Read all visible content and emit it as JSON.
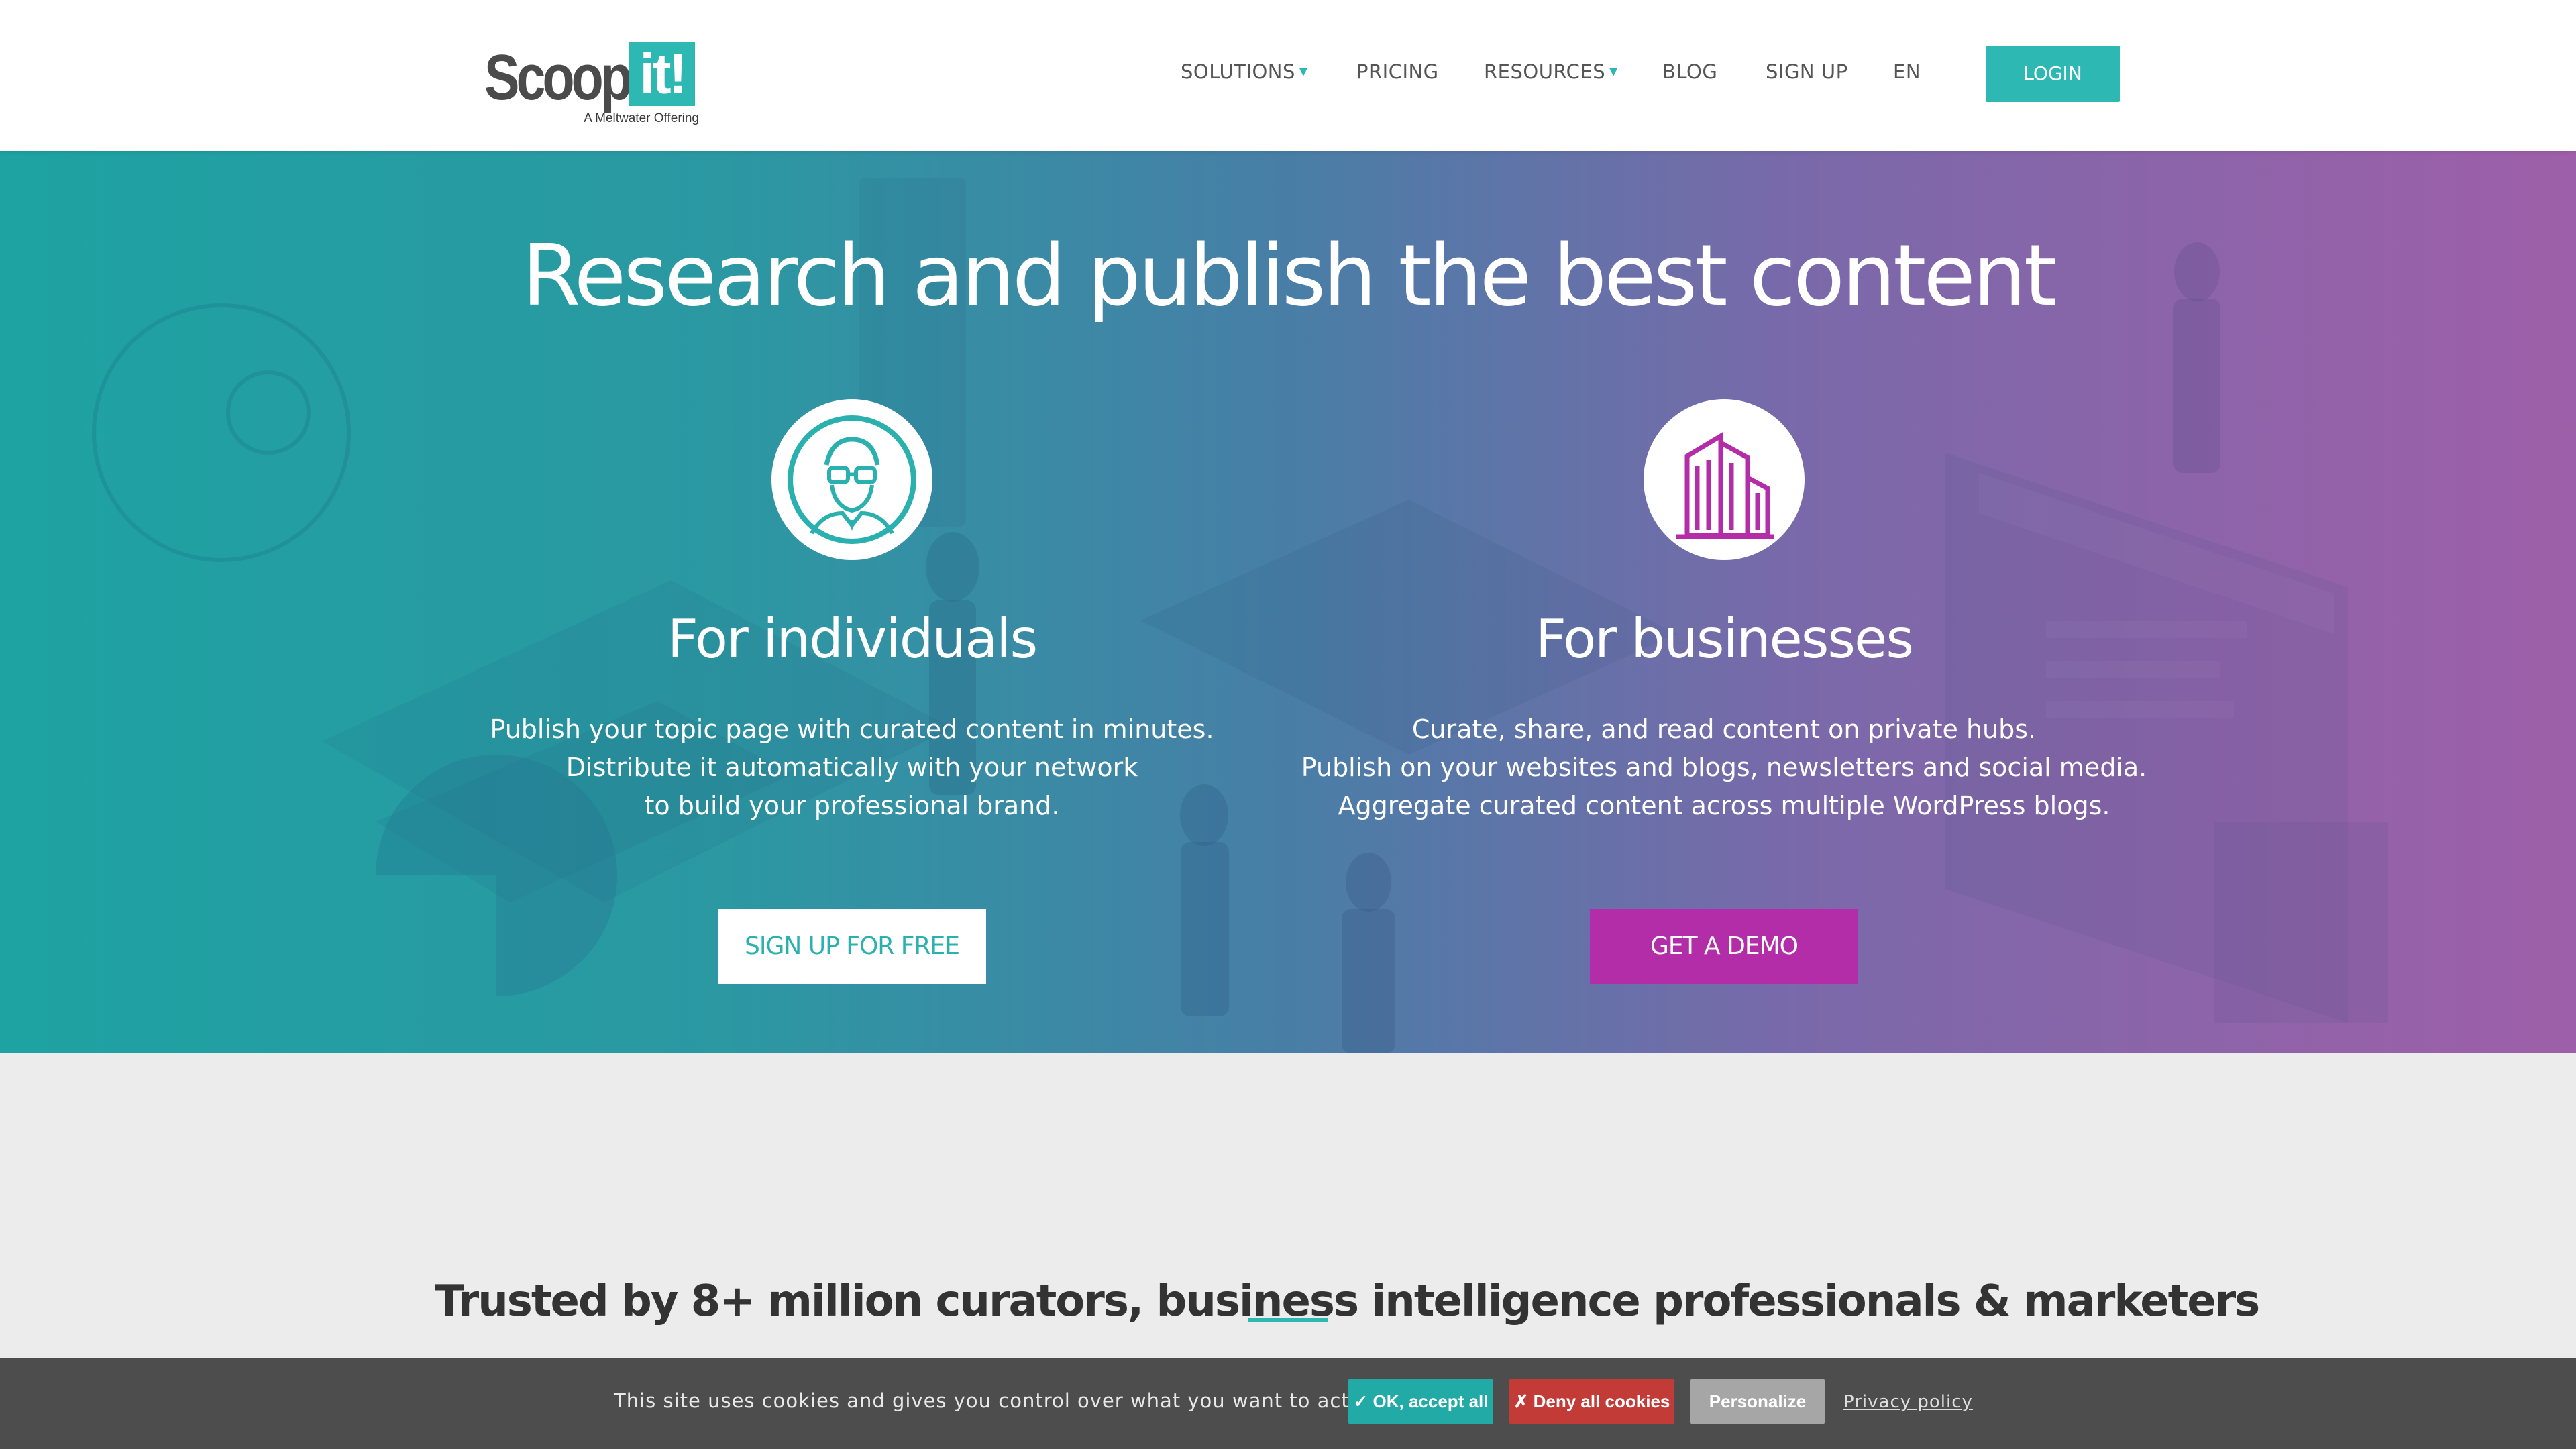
{
  "header": {
    "logo": {
      "word": "Scoop.",
      "badge": "it!",
      "tagline": "A Meltwater Offering"
    },
    "nav": [
      {
        "label": "SOLUTIONS",
        "caret": "▾"
      },
      {
        "label": "PRICING"
      },
      {
        "label": "RESOURCES",
        "caret": "▾"
      },
      {
        "label": "BLOG"
      },
      {
        "label": "SIGN UP"
      },
      {
        "label": "EN"
      }
    ],
    "login_label": "LOGIN"
  },
  "hero": {
    "title": "Research and publish the best content",
    "individuals": {
      "icon": "person-with-glasses-icon",
      "heading": "For individuals",
      "lines": [
        "Publish your topic page with curated content in minutes.",
        "Distribute it automatically with your network",
        "to build your professional brand."
      ],
      "cta": "SIGN UP FOR FREE"
    },
    "businesses": {
      "icon": "office-buildings-icon",
      "heading": "For businesses",
      "lines": [
        "Curate, share, and read content on private hubs.",
        "Publish on your websites and blogs, newsletters and social media.",
        "Aggregate curated content across multiple WordPress blogs."
      ],
      "cta": "GET A DEMO"
    }
  },
  "trusted": {
    "heading": "Trusted by 8+ million curators, business intelligence professionals & marketers"
  },
  "cookie_bar": {
    "text": "This site uses cookies and gives you control over what you want to activate",
    "accept_label": "✓ OK, accept all",
    "deny_label": "✗ Deny all cookies",
    "personalize_label": "Personalize",
    "privacy_label": "Privacy policy"
  },
  "colors": {
    "accent": "#2db8b4",
    "magenta": "#b32ca8",
    "deny": "#c23b36",
    "cookie_bar": "#4d4d4d"
  }
}
